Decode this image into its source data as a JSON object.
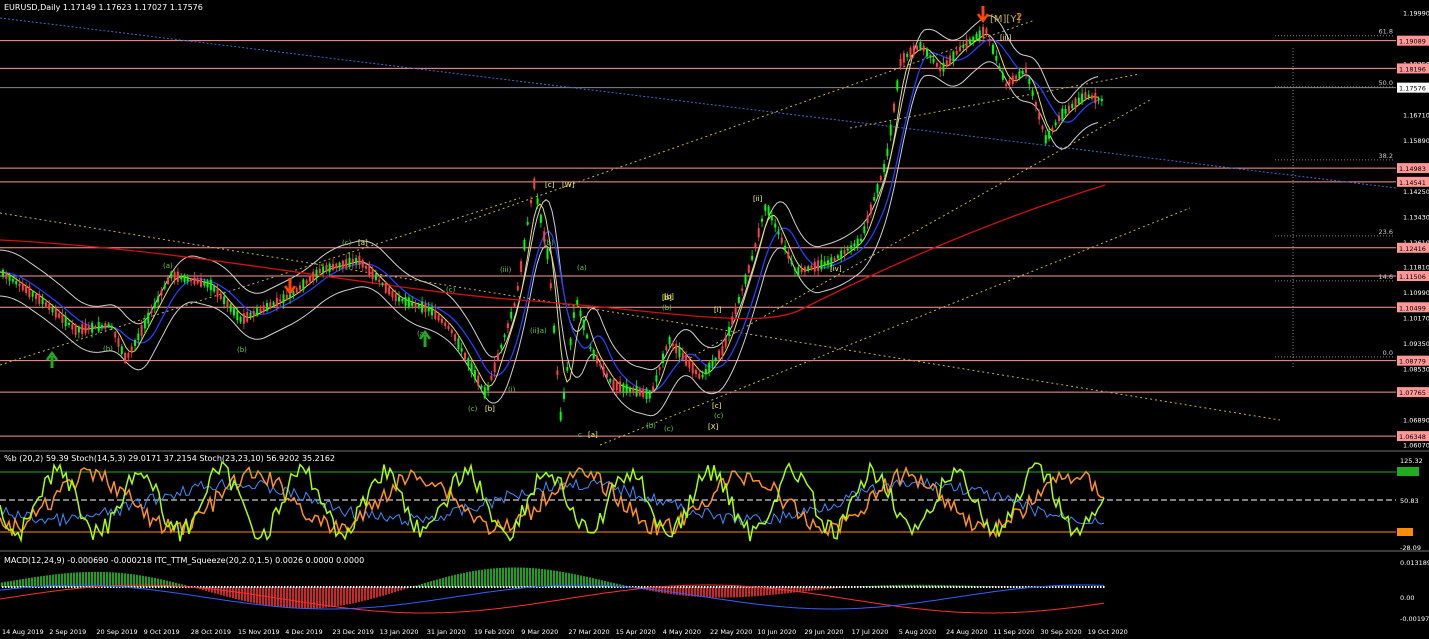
{
  "main": {
    "title": "EURUSD,Daily  1.17149 1.17623 1.17027 1.17576",
    "wave_top_label": "[M][Y]",
    "wave_top_number": "2",
    "fib_labels": [
      "61.8",
      "50.0",
      "38.2",
      "23.6",
      "14.6",
      "0.0"
    ],
    "price_scale": [
      "1.19990",
      "1.19170",
      "1.18350",
      "1.17530",
      "1.16710",
      "1.15890",
      "1.15070",
      "1.14250",
      "1.13430",
      "1.12610",
      "1.11810",
      "1.10990",
      "1.10170",
      "1.09350",
      "1.08530",
      "1.07710",
      "1.06890",
      "1.06070"
    ],
    "level_boxes": [
      {
        "label": "1.19089",
        "color": "#ff9999"
      },
      {
        "label": "1.18196",
        "color": "#ff9999"
      },
      {
        "label": "1.17576",
        "color": "#ffffff"
      },
      {
        "label": "1.14983",
        "color": "#ff9999"
      },
      {
        "label": "1.14541",
        "color": "#ff9999"
      },
      {
        "label": "1.12416",
        "color": "#ff9999"
      },
      {
        "label": "1.11506",
        "color": "#ff9999"
      },
      {
        "label": "1.10499",
        "color": "#ff9999"
      },
      {
        "label": "1.08779",
        "color": "#ff9999"
      },
      {
        "label": "1.07765",
        "color": "#ff9999"
      },
      {
        "label": "1.06348",
        "color": "#ff9999"
      }
    ],
    "wave_labels": [
      "(a)",
      "(c)",
      "[a]",
      "(b)",
      "(b)",
      "(a)",
      "(c)",
      "[b]",
      "(b)",
      "(iii)",
      "(i)",
      "(ii)",
      "(c)",
      "[b]",
      "[c]",
      "[W]",
      "(b)",
      "(a)",
      "(a)",
      "(c)",
      "[b]",
      "(c)",
      "[i]",
      "[ii]",
      "[iii]",
      "[iv]",
      "(b)",
      "[c]",
      "[X]",
      "c",
      "[a]"
    ]
  },
  "oscillator": {
    "title": "%b (20,2) 59.39  Stoch(14,5,3) 29.0171 37.2154  Stoch(23,23,10) 56.9202 35.2162",
    "scale": [
      "125.32",
      "80",
      "50.83",
      "20",
      "-28.09"
    ]
  },
  "macd": {
    "title": "MACD(12,24,9) -0.000690 -0.000218  ITC_TTM_Squeeze(20,2.0,1.5) 0.0026 0.0000 0.0000",
    "scale": [
      "0.013189",
      "0.00",
      "-0.001976"
    ]
  },
  "time_axis": [
    "14 Aug 2019",
    "2 Sep 2019",
    "20 Sep 2019",
    "9 Oct 2019",
    "28 Oct 2019",
    "15 Nov 2019",
    "4 Dec 2019",
    "23 Dec 2019",
    "13 Jan 2020",
    "31 Jan 2020",
    "19 Feb 2020",
    "9 Mar 2020",
    "27 Mar 2020",
    "15 Apr 2020",
    "4 May 2020",
    "22 May 2020",
    "10 Jun 2020",
    "29 Jun 2020",
    "17 Jul 2020",
    "5 Aug 2020",
    "24 Aug 2020",
    "11 Sep 2020",
    "30 Sep 2020",
    "19 Oct 2020"
  ],
  "colors": {
    "bull_candle": "#00ff00",
    "bear_candle": "#ff4040",
    "level_line": "#ff9999",
    "accent_arrow": "#ff4500",
    "ma_blue": "#1e40ff",
    "ma_red": "#d01010",
    "band": "#cfcfcf",
    "yellow": "#e8e060"
  }
}
